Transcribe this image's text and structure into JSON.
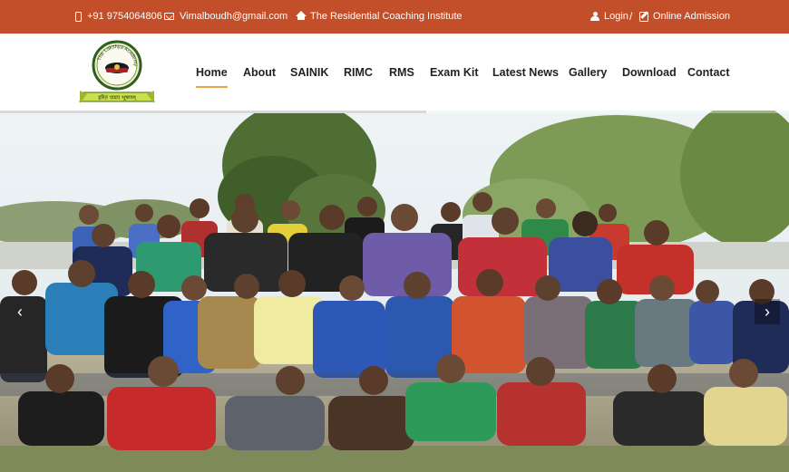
{
  "topbar": {
    "phone": "+91 9754064806",
    "email": "Vimalboudh@gmail.com",
    "tagline": "The Residential Coaching Institute",
    "login": "Login",
    "separator": "/",
    "admission": "Online Admission",
    "bg_color": "#c24e2a"
  },
  "logo": {
    "ring_text": "The Lakshya Academy",
    "ribbon_text": "हरितं पादप भूषणम्"
  },
  "nav": {
    "items": [
      "Home",
      "About",
      "SAINIK",
      "RIMC",
      "RMS",
      "Exam Kit",
      "Latest News",
      "Gallery",
      "Download",
      "Contact"
    ],
    "active": "Home",
    "accent": "#e8a34a"
  },
  "slider": {
    "prev_icon": "chevron-left-icon",
    "next_icon": "chevron-right-icon",
    "prev_glyph": "‹",
    "next_glyph": "›",
    "progress": 0.54
  }
}
